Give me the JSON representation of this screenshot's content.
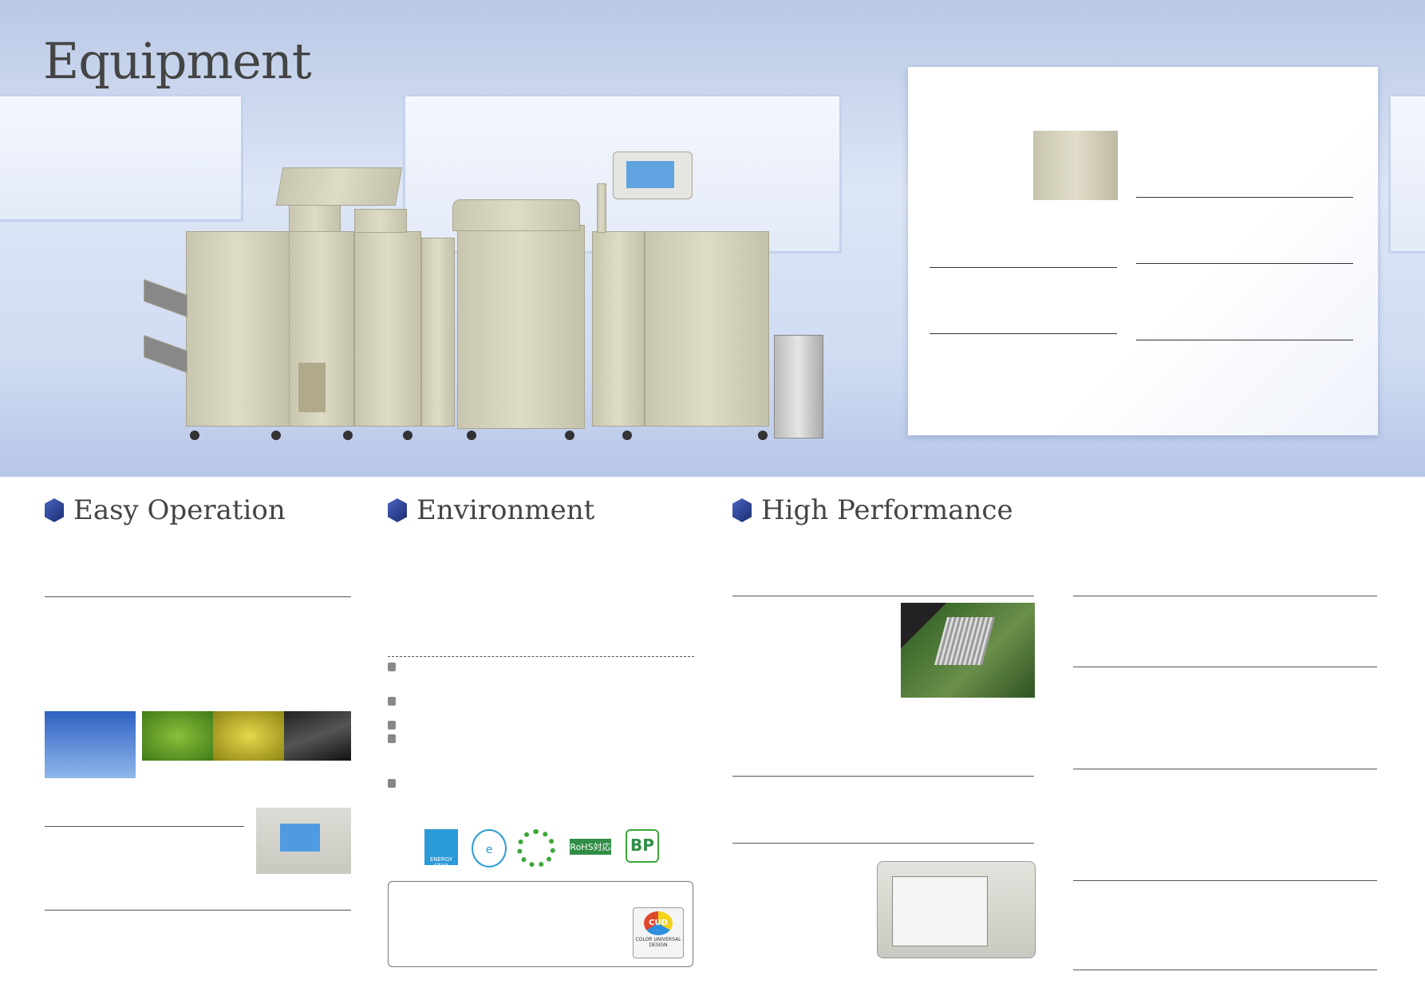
{
  "page": {
    "title": "Equipment"
  },
  "sections": {
    "easy_operation": {
      "heading": "Easy Operation"
    },
    "environment": {
      "heading": "Environment"
    },
    "high_performance": {
      "heading": "High Performance"
    }
  },
  "logos": {
    "energy_star": "ENERGY STAR",
    "rohs": "RoHS対応",
    "biomass": "BP",
    "cud": "CUD",
    "cud_caption": "COLOR UNIVERSAL DESIGN"
  },
  "colors": {
    "heading_icon": "#2b3f94",
    "hero_bg": "#cfdcf2",
    "printer": "#d3d0ba"
  }
}
